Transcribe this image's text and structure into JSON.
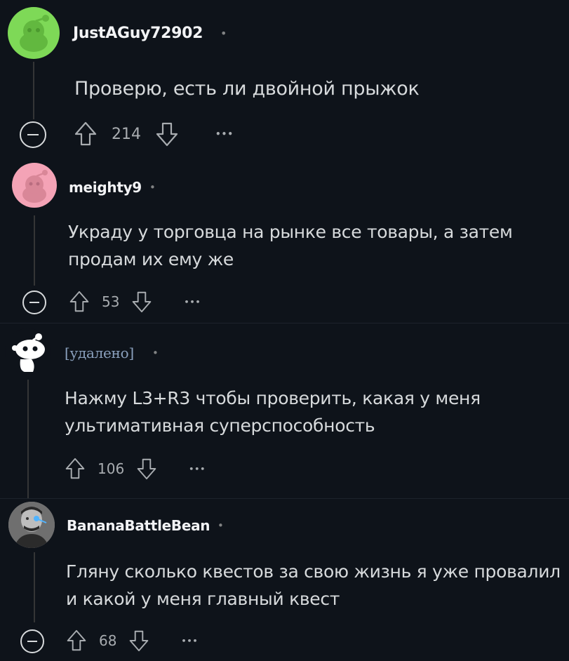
{
  "comments": [
    {
      "username": "JustAGuy72902",
      "text": "Проверю, есть ли двойной прыжок",
      "score": "214",
      "avatar_color": "#7ed957"
    },
    {
      "username": "meighty9",
      "text_lines": [
        "Украду у торговца на рынке все товары, а затем",
        "продам их ему же"
      ],
      "score": "53",
      "avatar_color": "#f4a3b6"
    },
    {
      "username": "[удалено]",
      "text_lines": [
        "Нажму L3+R3 чтобы проверить, какая у меня",
        "ультимативная суперспособность"
      ],
      "score": "106",
      "avatar_color": "#ffffff"
    },
    {
      "username": "BananaBattleBean",
      "text_lines": [
        "Гляну сколько квестов за свою жизнь я уже провалил",
        "и какой у меня главный квест"
      ],
      "score": "68",
      "avatar_color": "#777777"
    }
  ],
  "separator": "•",
  "more_label": "•••",
  "colors": {
    "background": "#0e131a",
    "text": "#d7dadc",
    "muted": "#818384"
  }
}
